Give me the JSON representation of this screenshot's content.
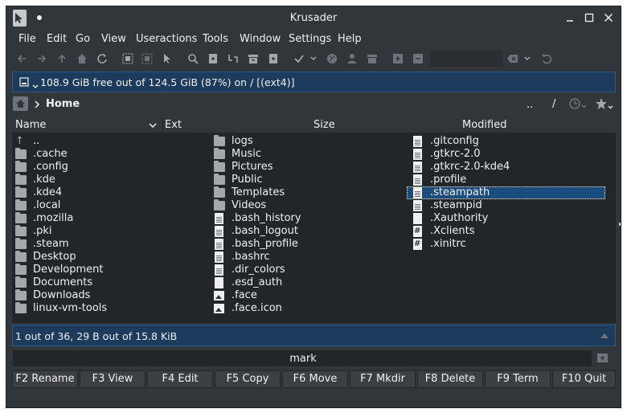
{
  "window": {
    "title": "Krusader"
  },
  "menu": [
    "File",
    "Edit",
    "Go",
    "View",
    "Useractions",
    "Tools",
    "Window",
    "Settings",
    "Help"
  ],
  "toolbar": {
    "icons": [
      "back-icon",
      "forward-icon",
      "up-icon",
      "home-icon",
      "refresh-icon",
      "select-all-icon",
      "unselect-icon",
      "pointer-icon",
      "search-icon",
      "new-file-icon",
      "sync-icon",
      "archive-icon",
      "add-icon",
      "check-icon",
      "globe-icon",
      "user-icon",
      "trash-icon",
      "zoom-in-icon",
      "zoom-out-icon",
      "clear-icon",
      "undo-icon"
    ]
  },
  "free_space": {
    "text": "108.9 GiB free out of 124.5 GiB (87%) on / [(ext4)]"
  },
  "path": {
    "label": "Home",
    "dotdot": "..",
    "slash": "/"
  },
  "columns": {
    "name": "Name",
    "ext": "Ext",
    "size": "Size",
    "modified": "Modified"
  },
  "files": {
    "col1": [
      {
        "name": "..",
        "type": "up"
      },
      {
        "name": ".cache",
        "type": "folder"
      },
      {
        "name": ".config",
        "type": "folder"
      },
      {
        "name": ".kde",
        "type": "folder"
      },
      {
        "name": ".kde4",
        "type": "folder"
      },
      {
        "name": ".local",
        "type": "folder"
      },
      {
        "name": ".mozilla",
        "type": "folder"
      },
      {
        "name": ".pki",
        "type": "folder"
      },
      {
        "name": ".steam",
        "type": "folder"
      },
      {
        "name": "Desktop",
        "type": "folder"
      },
      {
        "name": "Development",
        "type": "folder"
      },
      {
        "name": "Documents",
        "type": "folder"
      },
      {
        "name": "Downloads",
        "type": "folder"
      },
      {
        "name": "linux-vm-tools",
        "type": "folder"
      }
    ],
    "col2": [
      {
        "name": "logs",
        "type": "folder"
      },
      {
        "name": "Music",
        "type": "folder"
      },
      {
        "name": "Pictures",
        "type": "folder"
      },
      {
        "name": "Public",
        "type": "folder"
      },
      {
        "name": "Templates",
        "type": "folder"
      },
      {
        "name": "Videos",
        "type": "folder"
      },
      {
        "name": ".bash_history",
        "type": "doc"
      },
      {
        "name": ".bash_logout",
        "type": "doc"
      },
      {
        "name": ".bash_profile",
        "type": "doc"
      },
      {
        "name": ".bashrc",
        "type": "doc"
      },
      {
        "name": ".dir_colors",
        "type": "doc"
      },
      {
        "name": ".esd_auth",
        "type": "blank"
      },
      {
        "name": ".face",
        "type": "image"
      },
      {
        "name": ".face.icon",
        "type": "image"
      }
    ],
    "col3": [
      {
        "name": ".gitconfig",
        "type": "doc"
      },
      {
        "name": ".gtkrc-2.0",
        "type": "doc"
      },
      {
        "name": ".gtkrc-2.0-kde4",
        "type": "doc"
      },
      {
        "name": ".profile",
        "type": "doc"
      },
      {
        "name": ".steampath",
        "type": "doc",
        "selected": true
      },
      {
        "name": ".steampid",
        "type": "doc"
      },
      {
        "name": ".Xauthority",
        "type": "blank"
      },
      {
        "name": ".Xclients",
        "type": "script"
      },
      {
        "name": ".xinitrc",
        "type": "script"
      }
    ]
  },
  "status": {
    "text": "1 out of 36, 29 B out of 15.8 KiB"
  },
  "command": {
    "text": "mark"
  },
  "fkeys": [
    "F2 Rename",
    "F3 View",
    "F4 Edit",
    "F5 Copy",
    "F6 Move",
    "F7 Mkdir",
    "F8 Delete",
    "F9 Term",
    "F10 Quit"
  ]
}
